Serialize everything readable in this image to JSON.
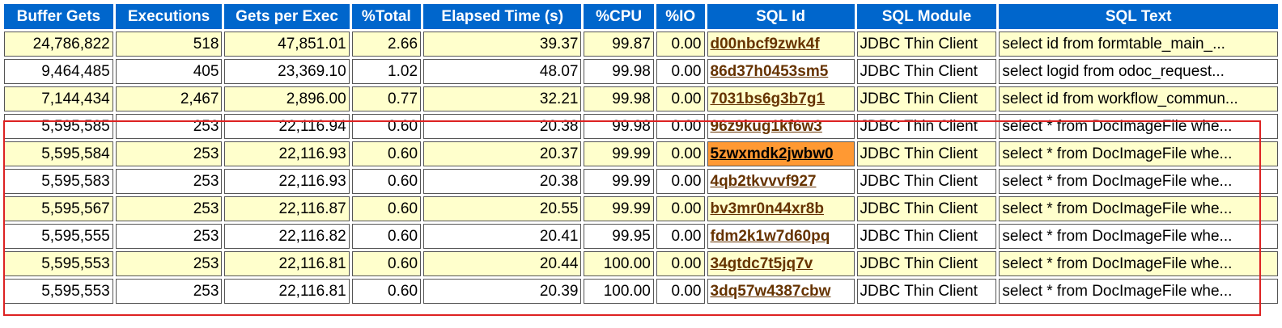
{
  "colors": {
    "header_bg": "#0066cc",
    "header_fg": "#ffffff",
    "row_alt_bg": "#ffffcc",
    "row_bg": "#ffffff",
    "sql_id_link": "#663300",
    "sql_id_highlight": "#ff9933",
    "selection_box": "#dd2222"
  },
  "table": {
    "headers": [
      "Buffer Gets",
      "Executions",
      "Gets per Exec",
      "%Total",
      "Elapsed Time (s)",
      "%CPU",
      "%IO",
      "SQL Id",
      "SQL Module",
      "SQL Text"
    ],
    "rows": [
      [
        "24,786,822",
        "518",
        "47,851.01",
        "2.66",
        "39.37",
        "99.87",
        "0.00",
        "d00nbcf9zwk4f",
        "JDBC Thin Client",
        "select id from formtable_main_..."
      ],
      [
        "9,464,485",
        "405",
        "23,369.10",
        "1.02",
        "48.07",
        "99.98",
        "0.00",
        "86d37h0453sm5",
        "JDBC Thin Client",
        "select logid from odoc_request..."
      ],
      [
        "7,144,434",
        "2,467",
        "2,896.00",
        "0.77",
        "32.21",
        "99.98",
        "0.00",
        "7031bs6g3b7g1",
        "JDBC Thin Client",
        "select id from workflow_commun..."
      ],
      [
        "5,595,585",
        "253",
        "22,116.94",
        "0.60",
        "20.38",
        "99.98",
        "0.00",
        "96z9kug1kf6w3",
        "JDBC Thin Client",
        "select * from DocImageFile whe..."
      ],
      [
        "5,595,584",
        "253",
        "22,116.93",
        "0.60",
        "20.37",
        "99.99",
        "0.00",
        "5zwxmdk2jwbw0",
        "JDBC Thin Client",
        "select * from DocImageFile whe..."
      ],
      [
        "5,595,583",
        "253",
        "22,116.93",
        "0.60",
        "20.38",
        "99.99",
        "0.00",
        "4qb2tkvvvf927",
        "JDBC Thin Client",
        "select * from DocImageFile whe..."
      ],
      [
        "5,595,567",
        "253",
        "22,116.87",
        "0.60",
        "20.55",
        "99.99",
        "0.00",
        "bv3mr0n44xr8b",
        "JDBC Thin Client",
        "select * from DocImageFile whe..."
      ],
      [
        "5,595,555",
        "253",
        "22,116.82",
        "0.60",
        "20.41",
        "99.95",
        "0.00",
        "fdm2k1w7d60pq",
        "JDBC Thin Client",
        "select * from DocImageFile whe..."
      ],
      [
        "5,595,553",
        "253",
        "22,116.81",
        "0.60",
        "20.44",
        "100.00",
        "0.00",
        "34gtdc7t5jq7v",
        "JDBC Thin Client",
        "select * from DocImageFile whe..."
      ],
      [
        "5,595,553",
        "253",
        "22,116.81",
        "0.60",
        "20.39",
        "100.00",
        "0.00",
        "3dq57w4387cbw",
        "JDBC Thin Client",
        "select * from DocImageFile whe..."
      ]
    ]
  }
}
